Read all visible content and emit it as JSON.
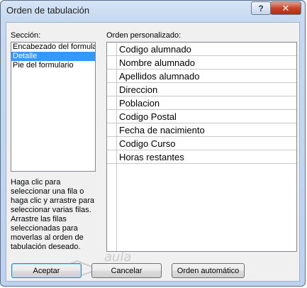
{
  "window": {
    "title": "Orden de tabulación"
  },
  "titlebar": {
    "help_label": "?",
    "close_label": "✕"
  },
  "section": {
    "label": "Sección:",
    "items": [
      {
        "label": "Encabezado del formula",
        "selected": false
      },
      {
        "label": "Detalle",
        "selected": true
      },
      {
        "label": "Pie del formulario",
        "selected": false
      }
    ]
  },
  "help": {
    "text": "Haga clic para seleccionar una fila o haga clic y arrastre para seleccionar varias filas. Arrastre las filas seleccionadas para moverlas al orden de tabulación deseado."
  },
  "order": {
    "label": "Orden personalizado:",
    "rows": [
      "Codigo alumnado",
      "Nombre alumnado",
      "Apellidos alumnado",
      "Direccion",
      "Poblacion",
      "Codigo Postal",
      "Fecha de nacimiento",
      "Codigo Curso",
      "Horas restantes"
    ]
  },
  "buttons": {
    "accept": "Aceptar",
    "cancel": "Cancelar",
    "auto": "Orden automático"
  },
  "colors": {
    "selection": "#3399ff",
    "title_gradient_top": "#d6e4f5",
    "close_button": "#c8452a"
  }
}
